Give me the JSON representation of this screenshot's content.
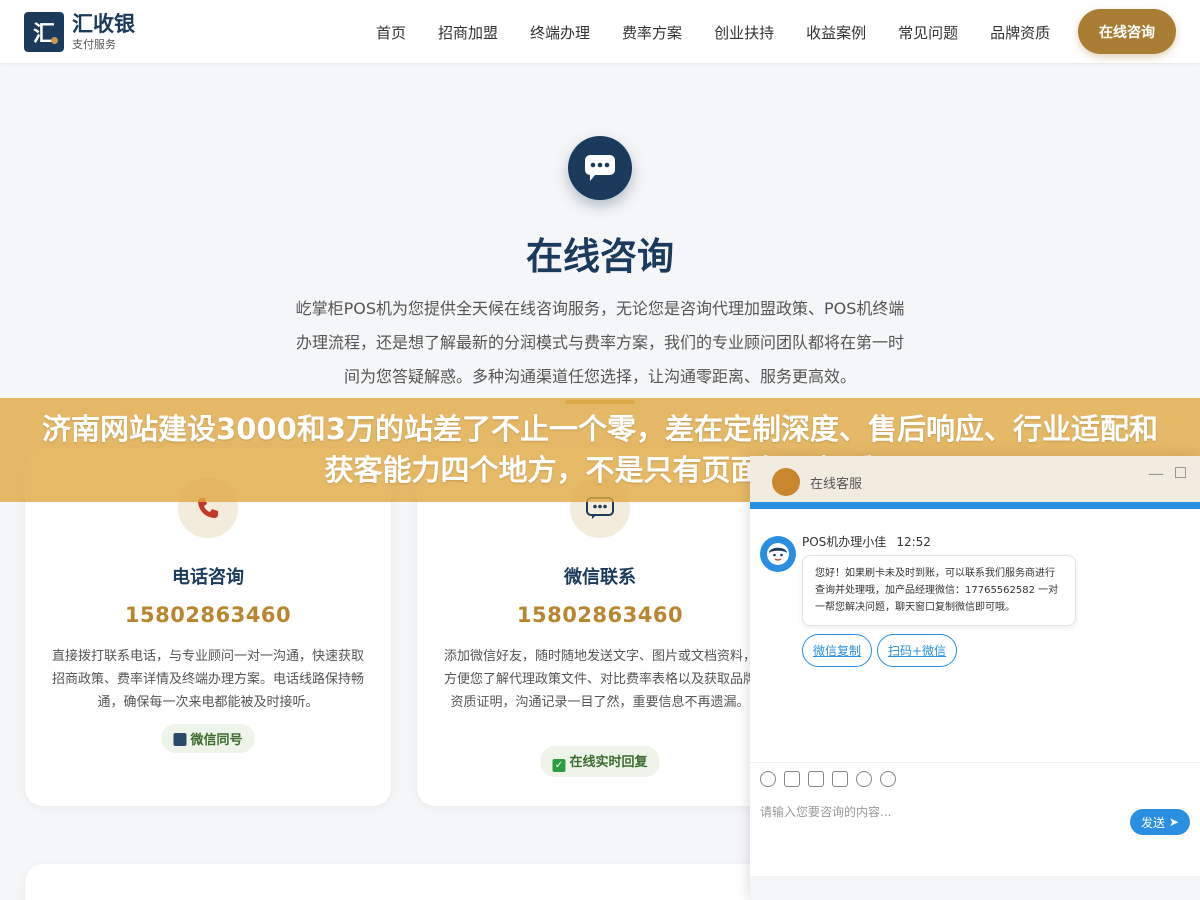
{
  "header": {
    "logo_char": "汇",
    "logo_name": "汇收银",
    "logo_sub": "支付服务",
    "nav": [
      "首页",
      "招商加盟",
      "终端办理",
      "费率方案",
      "创业扶持",
      "收益案例",
      "常见问题",
      "品牌资质"
    ],
    "cta_label": "在线咨询"
  },
  "hero": {
    "icon": "chat-bubble-icon",
    "title": "在线咨询",
    "desc": "屹掌柜POS机为您提供全天候在线咨询服务，无论您是咨询代理加盟政策、POS机终端办理流程，还是想了解最新的分润模式与费率方案，我们的专业顾问团队都将在第一时间为您答疑解惑。多种沟通渠道任您选择，让沟通零距离、服务更高效。"
  },
  "banner": {
    "text": "济南网站建设3000和3万的站差了不止一个零，差在定制深度、售后响应、行业适配和获客能力四个地方，不是只有页面好不好看"
  },
  "cards": [
    {
      "icon": "phone-icon",
      "title": "电话咨询",
      "phone": "15802863460",
      "desc": "直接拨打联系电话，与专业顾问一对一沟通，快速获取招商政策、费率详情及终端办理方案。电话线路保持畅通，确保每一次来电都能被及时接听。",
      "badge": "微信同号"
    },
    {
      "icon": "wechat-icon",
      "title": "微信联系",
      "phone": "15802863460",
      "desc": "添加微信好友，随时随地发送文字、图片或文档资料，方便您了解代理政策文件、对比费率表格以及获取品牌资质证明，沟通记录一目了然，重要信息不再遗漏。",
      "badge": "在线实时回复"
    }
  ],
  "chat": {
    "head_name": "在线客服",
    "agent_name": "POS机办理小佳",
    "time": "12:52",
    "message": "您好！如果刷卡未及时到账，可以联系我们服务商进行查询并处理哦，加产品经理微信：17765562582 一对一帮您解决问题，聊天窗口复制微信即可哦。",
    "buttons": [
      "微信复制",
      "扫码+微信"
    ],
    "input_placeholder": "请输入您要咨询的内容...",
    "send_label": "发送"
  },
  "colors": {
    "navy": "#1b3a5c",
    "gold": "#a97d34",
    "banner": "#e1aa46",
    "chat_blue": "#2a8fe0"
  }
}
